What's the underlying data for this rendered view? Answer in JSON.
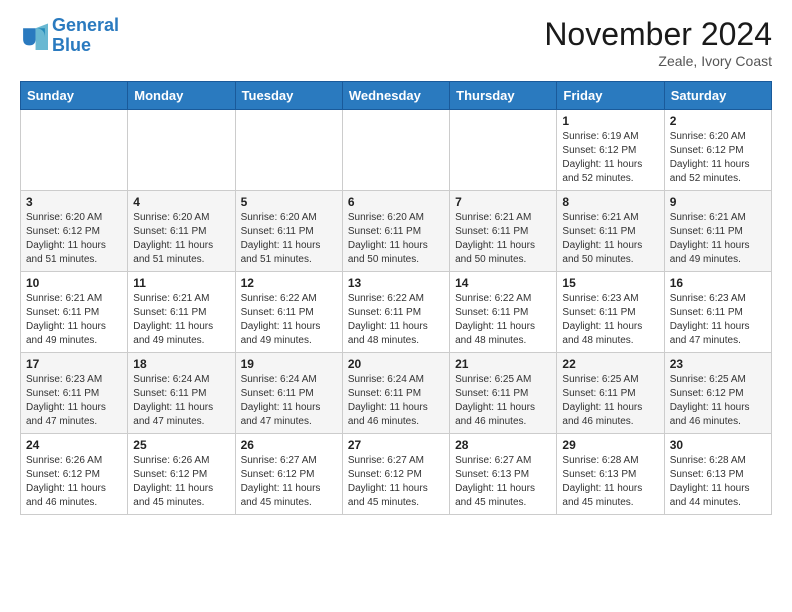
{
  "header": {
    "logo_line1": "General",
    "logo_line2": "Blue",
    "month": "November 2024",
    "location": "Zeale, Ivory Coast"
  },
  "days_of_week": [
    "Sunday",
    "Monday",
    "Tuesday",
    "Wednesday",
    "Thursday",
    "Friday",
    "Saturday"
  ],
  "weeks": [
    [
      {
        "day": "",
        "info": ""
      },
      {
        "day": "",
        "info": ""
      },
      {
        "day": "",
        "info": ""
      },
      {
        "day": "",
        "info": ""
      },
      {
        "day": "",
        "info": ""
      },
      {
        "day": "1",
        "info": "Sunrise: 6:19 AM\nSunset: 6:12 PM\nDaylight: 11 hours and 52 minutes."
      },
      {
        "day": "2",
        "info": "Sunrise: 6:20 AM\nSunset: 6:12 PM\nDaylight: 11 hours and 52 minutes."
      }
    ],
    [
      {
        "day": "3",
        "info": "Sunrise: 6:20 AM\nSunset: 6:12 PM\nDaylight: 11 hours and 51 minutes."
      },
      {
        "day": "4",
        "info": "Sunrise: 6:20 AM\nSunset: 6:11 PM\nDaylight: 11 hours and 51 minutes."
      },
      {
        "day": "5",
        "info": "Sunrise: 6:20 AM\nSunset: 6:11 PM\nDaylight: 11 hours and 51 minutes."
      },
      {
        "day": "6",
        "info": "Sunrise: 6:20 AM\nSunset: 6:11 PM\nDaylight: 11 hours and 50 minutes."
      },
      {
        "day": "7",
        "info": "Sunrise: 6:21 AM\nSunset: 6:11 PM\nDaylight: 11 hours and 50 minutes."
      },
      {
        "day": "8",
        "info": "Sunrise: 6:21 AM\nSunset: 6:11 PM\nDaylight: 11 hours and 50 minutes."
      },
      {
        "day": "9",
        "info": "Sunrise: 6:21 AM\nSunset: 6:11 PM\nDaylight: 11 hours and 49 minutes."
      }
    ],
    [
      {
        "day": "10",
        "info": "Sunrise: 6:21 AM\nSunset: 6:11 PM\nDaylight: 11 hours and 49 minutes."
      },
      {
        "day": "11",
        "info": "Sunrise: 6:21 AM\nSunset: 6:11 PM\nDaylight: 11 hours and 49 minutes."
      },
      {
        "day": "12",
        "info": "Sunrise: 6:22 AM\nSunset: 6:11 PM\nDaylight: 11 hours and 49 minutes."
      },
      {
        "day": "13",
        "info": "Sunrise: 6:22 AM\nSunset: 6:11 PM\nDaylight: 11 hours and 48 minutes."
      },
      {
        "day": "14",
        "info": "Sunrise: 6:22 AM\nSunset: 6:11 PM\nDaylight: 11 hours and 48 minutes."
      },
      {
        "day": "15",
        "info": "Sunrise: 6:23 AM\nSunset: 6:11 PM\nDaylight: 11 hours and 48 minutes."
      },
      {
        "day": "16",
        "info": "Sunrise: 6:23 AM\nSunset: 6:11 PM\nDaylight: 11 hours and 47 minutes."
      }
    ],
    [
      {
        "day": "17",
        "info": "Sunrise: 6:23 AM\nSunset: 6:11 PM\nDaylight: 11 hours and 47 minutes."
      },
      {
        "day": "18",
        "info": "Sunrise: 6:24 AM\nSunset: 6:11 PM\nDaylight: 11 hours and 47 minutes."
      },
      {
        "day": "19",
        "info": "Sunrise: 6:24 AM\nSunset: 6:11 PM\nDaylight: 11 hours and 47 minutes."
      },
      {
        "day": "20",
        "info": "Sunrise: 6:24 AM\nSunset: 6:11 PM\nDaylight: 11 hours and 46 minutes."
      },
      {
        "day": "21",
        "info": "Sunrise: 6:25 AM\nSunset: 6:11 PM\nDaylight: 11 hours and 46 minutes."
      },
      {
        "day": "22",
        "info": "Sunrise: 6:25 AM\nSunset: 6:11 PM\nDaylight: 11 hours and 46 minutes."
      },
      {
        "day": "23",
        "info": "Sunrise: 6:25 AM\nSunset: 6:12 PM\nDaylight: 11 hours and 46 minutes."
      }
    ],
    [
      {
        "day": "24",
        "info": "Sunrise: 6:26 AM\nSunset: 6:12 PM\nDaylight: 11 hours and 46 minutes."
      },
      {
        "day": "25",
        "info": "Sunrise: 6:26 AM\nSunset: 6:12 PM\nDaylight: 11 hours and 45 minutes."
      },
      {
        "day": "26",
        "info": "Sunrise: 6:27 AM\nSunset: 6:12 PM\nDaylight: 11 hours and 45 minutes."
      },
      {
        "day": "27",
        "info": "Sunrise: 6:27 AM\nSunset: 6:12 PM\nDaylight: 11 hours and 45 minutes."
      },
      {
        "day": "28",
        "info": "Sunrise: 6:27 AM\nSunset: 6:13 PM\nDaylight: 11 hours and 45 minutes."
      },
      {
        "day": "29",
        "info": "Sunrise: 6:28 AM\nSunset: 6:13 PM\nDaylight: 11 hours and 45 minutes."
      },
      {
        "day": "30",
        "info": "Sunrise: 6:28 AM\nSunset: 6:13 PM\nDaylight: 11 hours and 44 minutes."
      }
    ]
  ]
}
